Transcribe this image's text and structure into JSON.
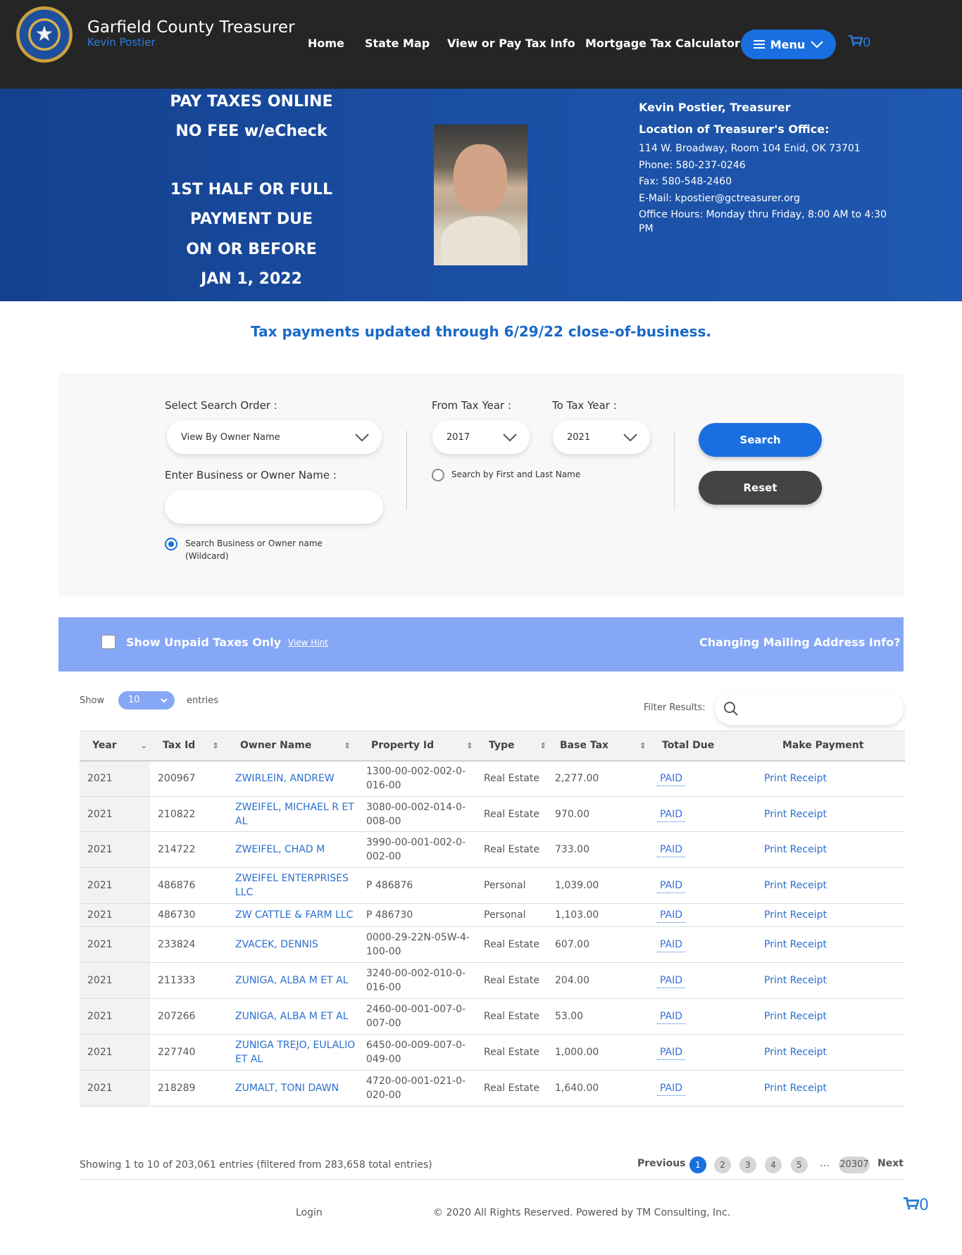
{
  "header": {
    "title": "Garfield County Treasurer",
    "subtitle": "Kevin Postier",
    "nav": [
      "Home",
      "State Map",
      "View or Pay Tax Info",
      "Mortgage Tax Calculator"
    ],
    "menu_label": "Menu",
    "cart_count": "0"
  },
  "banner": {
    "promo_lines": [
      "PAY TAXES ONLINE",
      "NO FEE w/eCheck",
      "1ST HALF OR FULL",
      "PAYMENT DUE",
      "ON OR BEFORE",
      "JAN 1, 2022"
    ],
    "name": "Kevin Postier, Treasurer",
    "location_title": "Location of Treasurer's Office:",
    "address": "114 W. Broadway, Room 104 Enid, OK 73701",
    "phone": "Phone: 580-237-0246",
    "fax": "Fax: 580-548-2460",
    "email": "E-Mail: kpostier@gctreasurer.org",
    "hours": "Office Hours: Monday thru Friday, 8:00 AM to 4:30 PM"
  },
  "updated_notice": "Tax payments updated through 6/29/22 close-of-business.",
  "search": {
    "order_label": "Select Search Order :",
    "order_value": "View By Owner Name",
    "from_label": "From Tax Year :",
    "from_value": "2017",
    "to_label": "To Tax Year :",
    "to_value": "2021",
    "name_label": "Enter Business or Owner Name :",
    "name_value": "",
    "first_last_label": "Search by First and Last Name",
    "wildcard_label_1": "Search Business or Owner name",
    "wildcard_label_2": "(Wildcard)",
    "search_button": "Search",
    "reset_button": "Reset"
  },
  "filter_bar": {
    "unpaid_label": "Show Unpaid Taxes Only",
    "hint_link": "View Hint",
    "mailing_link": "Changing Mailing Address Info?"
  },
  "table_controls": {
    "show": "Show",
    "entries_value": "10",
    "entries": "entries",
    "filter_label": "Filter Results:"
  },
  "table": {
    "headers": [
      "Year",
      "Tax Id",
      "Owner Name",
      "Property Id",
      "Type",
      "Base Tax",
      "Total Due",
      "Make Payment"
    ],
    "rows": [
      {
        "year": "2021",
        "tax_id": "200967",
        "owner": "ZWIRLEIN, ANDREW",
        "property": "1300-00-002-002-0-016-00",
        "type": "Real Estate",
        "base": "2,277.00",
        "due": "PAID",
        "action": "Print Receipt"
      },
      {
        "year": "2021",
        "tax_id": "210822",
        "owner": "ZWEIFEL, MICHAEL R ET AL",
        "property": "3080-00-002-014-0-008-00",
        "type": "Real Estate",
        "base": "970.00",
        "due": "PAID",
        "action": "Print Receipt"
      },
      {
        "year": "2021",
        "tax_id": "214722",
        "owner": "ZWEIFEL, CHAD M",
        "property": "3990-00-001-002-0-002-00",
        "type": "Real Estate",
        "base": "733.00",
        "due": "PAID",
        "action": "Print Receipt"
      },
      {
        "year": "2021",
        "tax_id": "486876",
        "owner": "ZWEIFEL ENTERPRISES LLC",
        "property": "P 486876",
        "type": "Personal",
        "base": "1,039.00",
        "due": "PAID",
        "action": "Print Receipt"
      },
      {
        "year": "2021",
        "tax_id": "486730",
        "owner": "ZW CATTLE & FARM LLC",
        "property": "P 486730",
        "type": "Personal",
        "base": "1,103.00",
        "due": "PAID",
        "action": "Print Receipt"
      },
      {
        "year": "2021",
        "tax_id": "233824",
        "owner": "ZVACEK, DENNIS",
        "property": "0000-29-22N-05W-4-100-00",
        "type": "Real Estate",
        "base": "607.00",
        "due": "PAID",
        "action": "Print Receipt"
      },
      {
        "year": "2021",
        "tax_id": "211333",
        "owner": "ZUNIGA, ALBA M ET AL",
        "property": "3240-00-002-010-0-016-00",
        "type": "Real Estate",
        "base": "204.00",
        "due": "PAID",
        "action": "Print Receipt"
      },
      {
        "year": "2021",
        "tax_id": "207266",
        "owner": "ZUNIGA, ALBA M ET AL",
        "property": "2460-00-001-007-0-007-00",
        "type": "Real Estate",
        "base": "53.00",
        "due": "PAID",
        "action": "Print Receipt"
      },
      {
        "year": "2021",
        "tax_id": "227740",
        "owner": "ZUNIGA TREJO, EULALIO ET AL",
        "property": "6450-00-009-007-0-049-00",
        "type": "Real Estate",
        "base": "1,000.00",
        "due": "PAID",
        "action": "Print Receipt"
      },
      {
        "year": "2021",
        "tax_id": "218289",
        "owner": "ZUMALT, TONI DAWN",
        "property": "4720-00-001-021-0-020-00",
        "type": "Real Estate",
        "base": "1,640.00",
        "due": "PAID",
        "action": "Print Receipt"
      }
    ]
  },
  "pagination": {
    "summary": "Showing 1 to 10 of 203,061 entries (filtered from 283,658 total entries)",
    "previous": "Previous",
    "pages": [
      "1",
      "2",
      "3",
      "4",
      "5"
    ],
    "ellipsis": "…",
    "last": "20307",
    "next": "Next"
  },
  "footer": {
    "login": "Login",
    "copyright": "© 2020 All Rights Reserved. Powered by TM Consulting, Inc.",
    "cart_count": "0"
  },
  "colors": {
    "header_bg": "#252525",
    "accent": "#1a6fe0",
    "banner": "#1a4fa3",
    "filter_bar": "#85a7f5"
  }
}
